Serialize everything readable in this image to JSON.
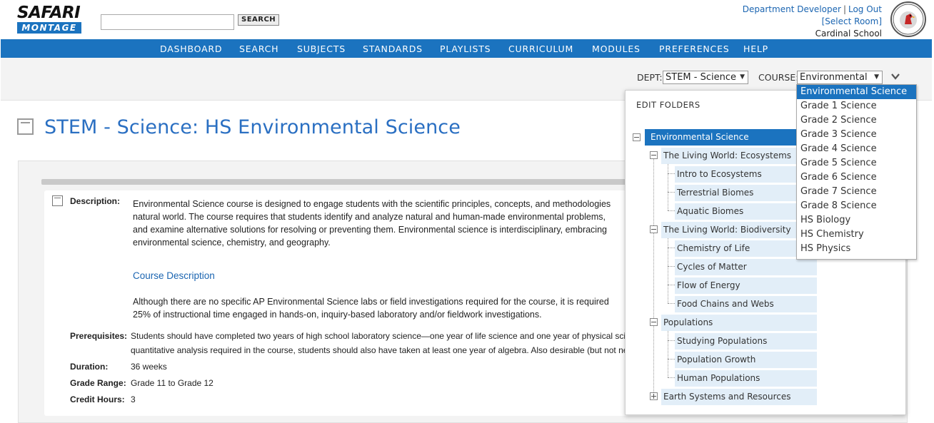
{
  "header": {
    "logo_top": "SAFARI",
    "logo_bottom": "MONTAGE",
    "search_button": "SEARCH",
    "user_name": "Department Developer",
    "separator": "|",
    "logout": "Log Out",
    "select_room": "[Select Room]",
    "school": "Cardinal School",
    "seal_top_text": "CARDINAL",
    "seal_bottom_text": "SCHOOL",
    "seal_year": "1945"
  },
  "nav": [
    "DASHBOARD",
    "SEARCH",
    "SUBJECTS",
    "STANDARDS",
    "PLAYLISTS",
    "CURRICULUM",
    "MODULES",
    "PREFERENCES",
    "HELP"
  ],
  "dept_bar": {
    "dept_label": "DEPT:",
    "dept_value": "STEM - Science",
    "course_label": "COURSE:",
    "course_value": "Environmental",
    "caret": "▼"
  },
  "page_title": "STEM - Science: HS Environmental Science",
  "description": {
    "label": "Description:",
    "lines": [
      "Environmental Science course is designed to engage students with the scientific principles, concepts, and methodologies",
      "natural world. The course requires that students identify and analyze natural and human-made environmental problems,",
      "and examine alternative solutions for resolving or preventing them. Environmental science is interdisciplinary, embracing",
      "environmental science, chemistry, and geography."
    ],
    "link": "Course Description",
    "lines2": [
      "Although there are no specific AP Environmental Science labs or field investigations required for the course, it is required",
      "25% of instructional time engaged in hands-on, inquiry-based laboratory and/or fieldwork investigations."
    ]
  },
  "details": {
    "prereq_label": "Prerequisites:",
    "prereq_lines": [
      "Students should have completed two years of high school laboratory science—one year of life science and one year of physical sci",
      "quantitative analysis required in the course, students should also have taken at least one year of algebra. Also desirable (but not ne"
    ],
    "duration_label": "Duration:",
    "duration": "36 weeks",
    "grade_label": "Grade Range:",
    "grade": "Grade 11 to Grade 12",
    "credit_label": "Credit Hours:",
    "credit": "3"
  },
  "folders": {
    "title": "EDIT FOLDERS",
    "root": "Environmental Science",
    "groups": [
      {
        "label": "The Living World: Ecosystems",
        "children": [
          "Intro to Ecosystems",
          "Terrestrial Biomes",
          "Aquatic Biomes"
        ]
      },
      {
        "label": "The Living World: Biodiversity",
        "children": [
          "Chemistry of Life",
          "Cycles of Matter",
          "Flow of Energy",
          "Food Chains and Webs"
        ]
      },
      {
        "label": "Populations",
        "children": [
          "Studying Populations",
          "Population Growth",
          "Human Populations"
        ]
      },
      {
        "label": "Earth Systems and Resources",
        "children": []
      }
    ]
  },
  "course_options": [
    "Environmental Science",
    "Grade 1 Science",
    "Grade 2 Science",
    "Grade 3 Science",
    "Grade 4 Science",
    "Grade 5 Science",
    "Grade 6 Science",
    "Grade 7 Science",
    "Grade 8 Science",
    "HS Biology",
    "HS Chemistry",
    "HS Physics"
  ],
  "colors": {
    "brand_blue": "#1b73bf",
    "link_blue": "#1b65b1",
    "tree_node_bg": "#e2eef8"
  },
  "icons": {
    "collapse": "collapse-chevron-icon",
    "toggle": "minus-box-icon",
    "expand": "plus-box-icon"
  }
}
